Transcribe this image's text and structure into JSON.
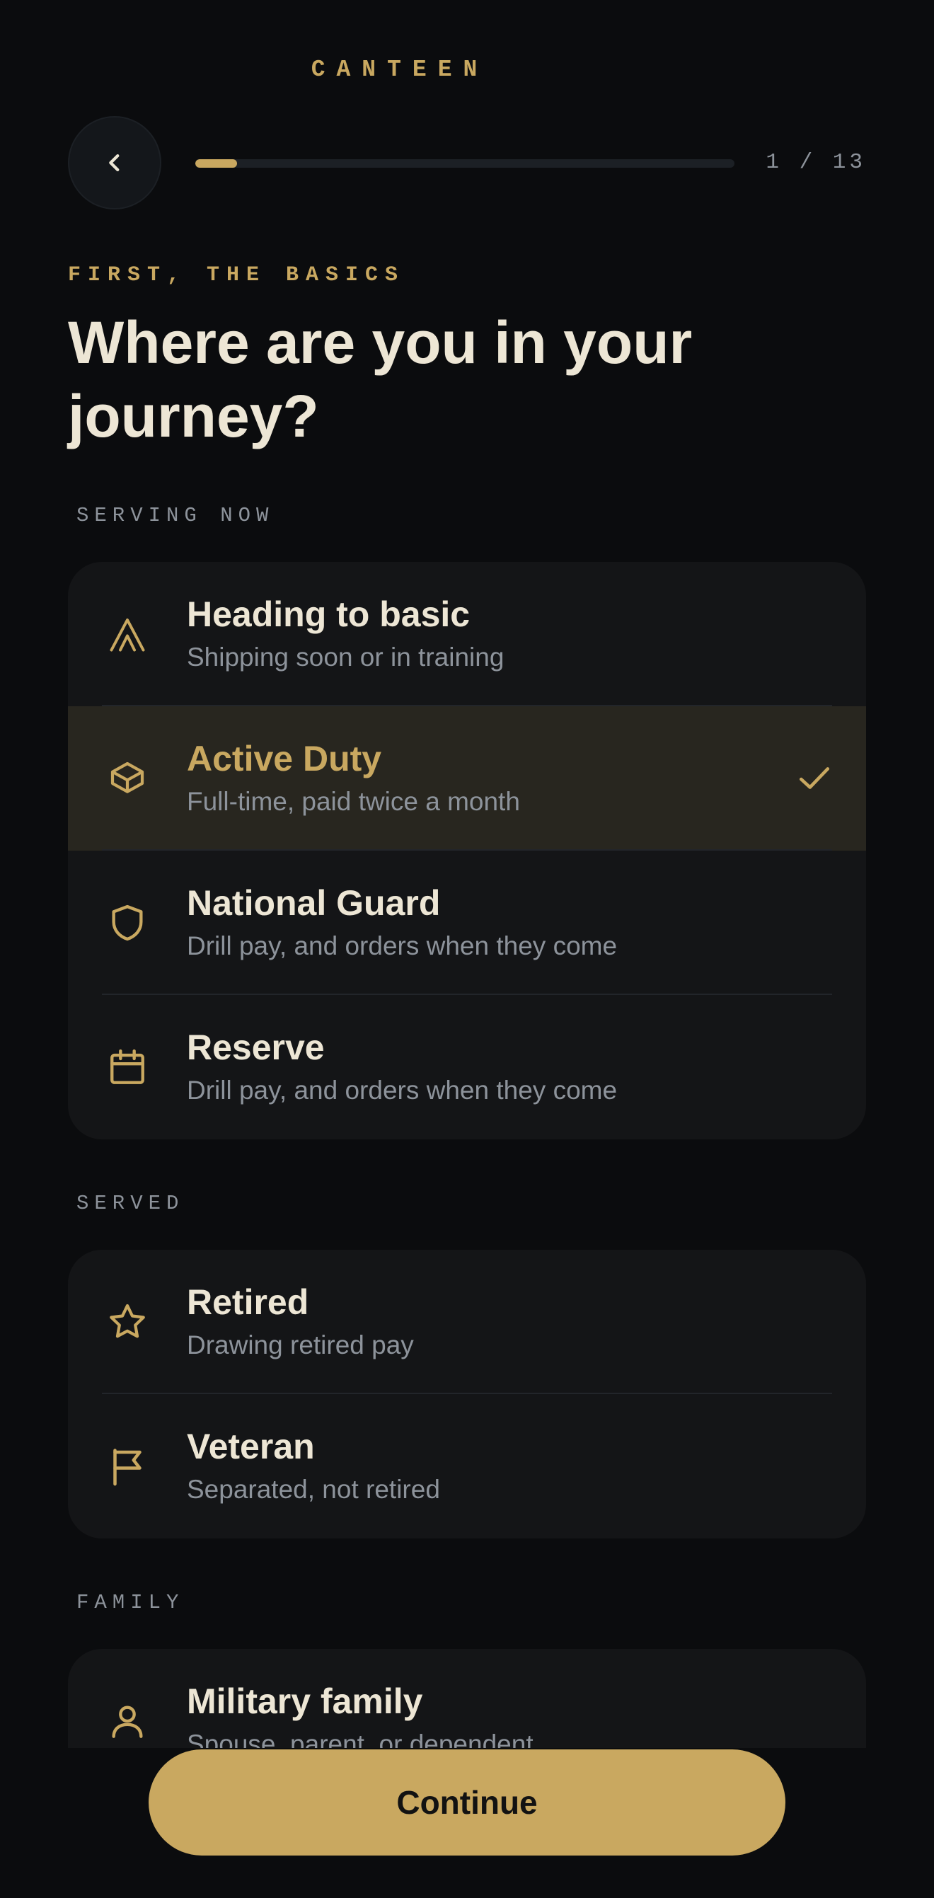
{
  "header": {
    "brand": "CANTEEN",
    "step": "1 / 13",
    "progress": 0.077,
    "icons": {
      "back": "chevron-left-icon"
    }
  },
  "intro": {
    "eyebrow": "FIRST, THE BASICS",
    "headline": "Where are you in your journey?"
  },
  "sections": {
    "serving_now": {
      "label": "SERVING NOW",
      "items": [
        {
          "title": "Heading to basic",
          "subtitle": "Shipping soon or in training",
          "icon": "chevron-up-double-icon",
          "selected": false
        },
        {
          "title": "Active Duty",
          "subtitle": "Full-time, paid twice a month",
          "icon": "box-icon",
          "selected": true
        },
        {
          "title": "National Guard",
          "subtitle": "Drill pay, and orders when they come",
          "icon": "shield-icon",
          "selected": false
        },
        {
          "title": "Reserve",
          "subtitle": "Drill pay, and orders when they come",
          "icon": "calendar-icon",
          "selected": false
        }
      ]
    },
    "served": {
      "label": "SERVED",
      "items": [
        {
          "title": "Retired",
          "subtitle": "Drawing retired pay",
          "icon": "star-icon",
          "selected": false
        },
        {
          "title": "Veteran",
          "subtitle": "Separated, not retired",
          "icon": "flag-icon",
          "selected": false
        }
      ]
    },
    "family": {
      "label": "FAMILY",
      "items": [
        {
          "title": "Military family",
          "subtitle": "Spouse, parent, or dependent",
          "icon": "person-icon",
          "selected": false
        }
      ]
    }
  },
  "footer": {
    "continue_label": "Continue"
  },
  "colors": {
    "background": "#0b0c0e",
    "card": "#141517",
    "selected_row": "#28261f",
    "accent": "#c9a860",
    "text_primary": "#ede6d5",
    "text_secondary": "#8d939b"
  }
}
